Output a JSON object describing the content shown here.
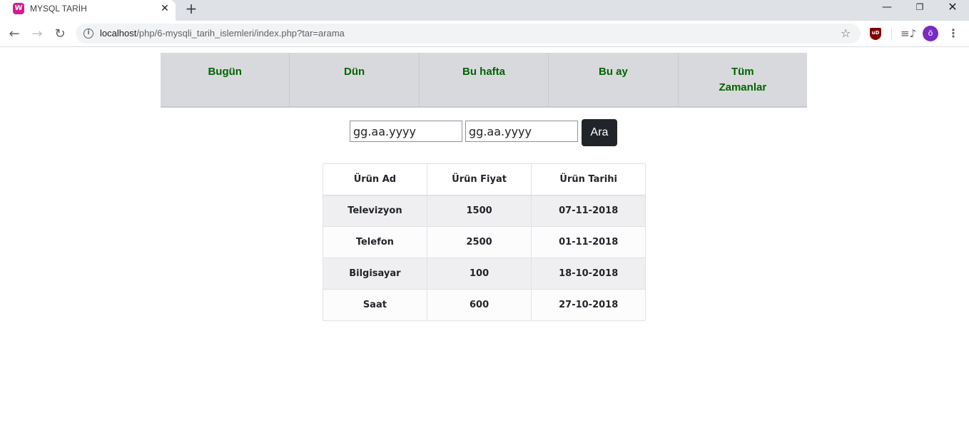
{
  "browser": {
    "tab": {
      "favicon_letter": "W",
      "title": "MYSQL TARİH",
      "close_symbol": "✕"
    },
    "new_tab_symbol": "+",
    "window_controls": {
      "minimize": "—",
      "maximize": "❐",
      "close": "✕"
    },
    "toolbar": {
      "back": "←",
      "forward": "→",
      "reload": "↻",
      "url_host": "localhost",
      "url_path": "/php/6-mysqli_tarih_islemleri/index.php?tar=arama",
      "star": "☆",
      "ublock_label": "uD",
      "media_symbol": "≡♪",
      "avatar_letter": "ö",
      "menu_symbol": "⋮"
    }
  },
  "nav_links": [
    "Bugün",
    "Dün",
    "Bu hafta",
    "Bu ay",
    "Tüm Zamanlar"
  ],
  "search": {
    "start_placeholder": "gg.aa.yyyy",
    "end_placeholder": "gg.aa.yyyy",
    "button_label": "Ara"
  },
  "table": {
    "headers": [
      "Ürün Ad",
      "Ürün Fiyat",
      "Ürün Tarihi"
    ],
    "rows": [
      [
        "Televizyon",
        "1500",
        "07-11-2018"
      ],
      [
        "Telefon",
        "2500",
        "01-11-2018"
      ],
      [
        "Bilgisayar",
        "100",
        "18-10-2018"
      ],
      [
        "Saat",
        "600",
        "27-10-2018"
      ]
    ]
  },
  "colors": {
    "nav_link": "#006400",
    "nav_bg": "#d8d9dc",
    "button_bg": "#212529",
    "row_odd": "#efeff1",
    "row_even": "#fcfcfd"
  }
}
